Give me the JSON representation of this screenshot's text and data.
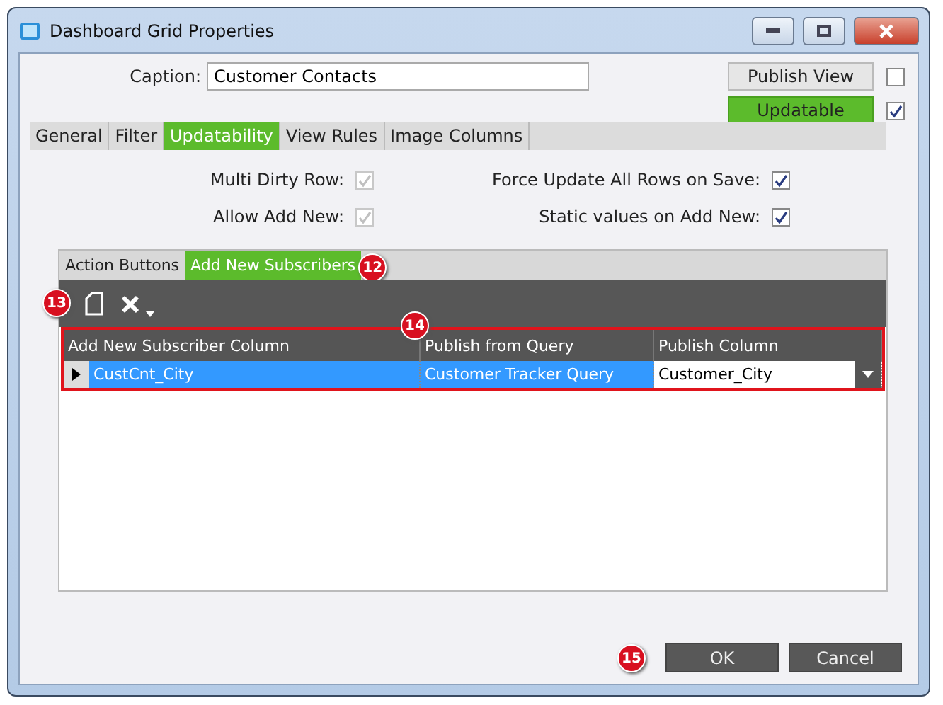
{
  "window": {
    "title": "Dashboard Grid Properties"
  },
  "caption": {
    "label": "Caption:",
    "value": "Customer Contacts"
  },
  "side_buttons": [
    {
      "label": "Publish View",
      "selected": false,
      "checked": false
    },
    {
      "label": "Updatable",
      "selected": true,
      "checked": true
    }
  ],
  "tabs": [
    {
      "label": "General",
      "selected": false
    },
    {
      "label": "Filter",
      "selected": false
    },
    {
      "label": "Updatability",
      "selected": true
    },
    {
      "label": "View Rules",
      "selected": false
    },
    {
      "label": "Image Columns",
      "selected": false
    }
  ],
  "options": [
    {
      "label": "Multi Dirty Row:",
      "checked": true,
      "disabled": true
    },
    {
      "label": "Force Update All Rows on Save:",
      "checked": true,
      "disabled": false
    },
    {
      "label": "Allow Add New:",
      "checked": true,
      "disabled": true
    },
    {
      "label": "Static values on Add New:",
      "checked": true,
      "disabled": false
    }
  ],
  "subtabs": [
    {
      "label": "Action Buttons",
      "selected": false
    },
    {
      "label": "Add New Subscribers",
      "selected": true
    }
  ],
  "grid": {
    "columns": [
      "Add New Subscriber Column",
      "Publish from Query",
      "Publish Column"
    ],
    "rows": [
      {
        "selected": true,
        "cells": [
          "CustCnt_City",
          "Customer Tracker Query",
          "Customer_City"
        ]
      }
    ]
  },
  "callouts": [
    "12",
    "13",
    "14",
    "15"
  ],
  "buttons": [
    "OK",
    "Cancel"
  ]
}
